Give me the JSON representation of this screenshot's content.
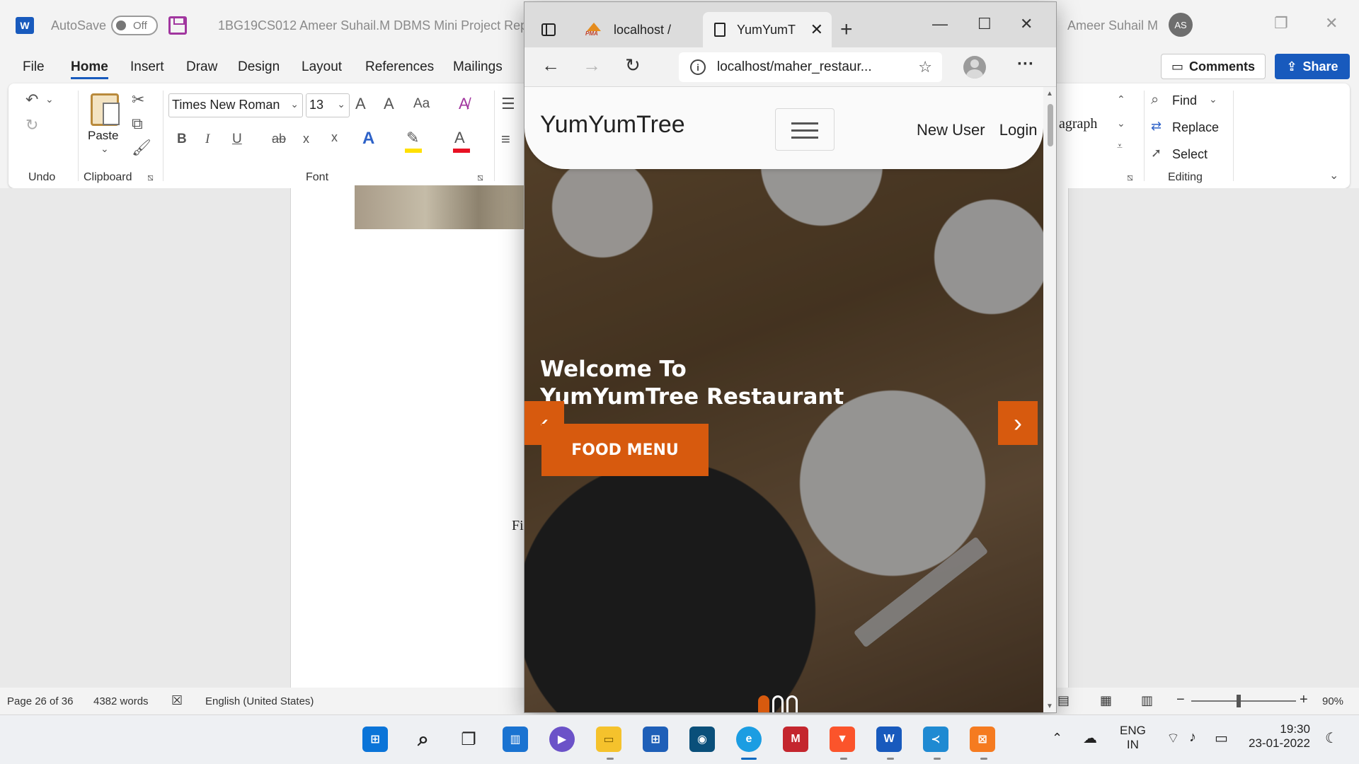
{
  "word": {
    "app_logo": "W",
    "autosave_label": "AutoSave",
    "autosave_state": "Off",
    "doc_title": "1BG19CS012 Ameer Suhail.M DBMS Mini Project Report",
    "user_name": "Ameer Suhail M",
    "user_initials": "AS",
    "menu": [
      "File",
      "Home",
      "Insert",
      "Draw",
      "Design",
      "Layout",
      "References",
      "Mailings"
    ],
    "comments_label": "Comments",
    "share_label": "Share",
    "ribbon": {
      "undo_group": "Undo",
      "clipboard_group": "Clipboard",
      "paste_label": "Paste",
      "font_group": "Font",
      "font_name": "Times New Roman",
      "font_size": "13",
      "grow_font": "A",
      "shrink_font": "A",
      "change_case": "Aa",
      "bold": "B",
      "italic": "I",
      "underline": "U",
      "strike": "ab",
      "subscript": "x",
      "superscript": "x",
      "text_effects": "A",
      "font_color": "A",
      "styles_partial": "agraph",
      "editing_group": "Editing",
      "find_label": "Find",
      "replace_label": "Replace",
      "select_label": "Select"
    },
    "doc": {
      "caption_partial": "Fi"
    },
    "status": {
      "page": "Page 26 of 36",
      "words": "4382 words",
      "language": "English (United States)",
      "zoom": "90%"
    }
  },
  "browser": {
    "tabs": [
      {
        "title": "localhost /",
        "active": false
      },
      {
        "title": "YumYumT",
        "active": true
      }
    ],
    "url": "localhost/maher_restaur...",
    "site": {
      "brand": "YumYumTree",
      "nav": [
        "New User",
        "Login"
      ],
      "hero_heading_line1": "Welcome To",
      "hero_heading_line2": "YumYumTree Restaurant",
      "cta": "FOOD MENU",
      "prev": "‹",
      "next": "›",
      "active_slide": 1,
      "slide_count": 3
    }
  },
  "taskbar": {
    "lang_line1": "ENG",
    "lang_line2": "IN",
    "time": "19:30",
    "date": "23-01-2022"
  }
}
